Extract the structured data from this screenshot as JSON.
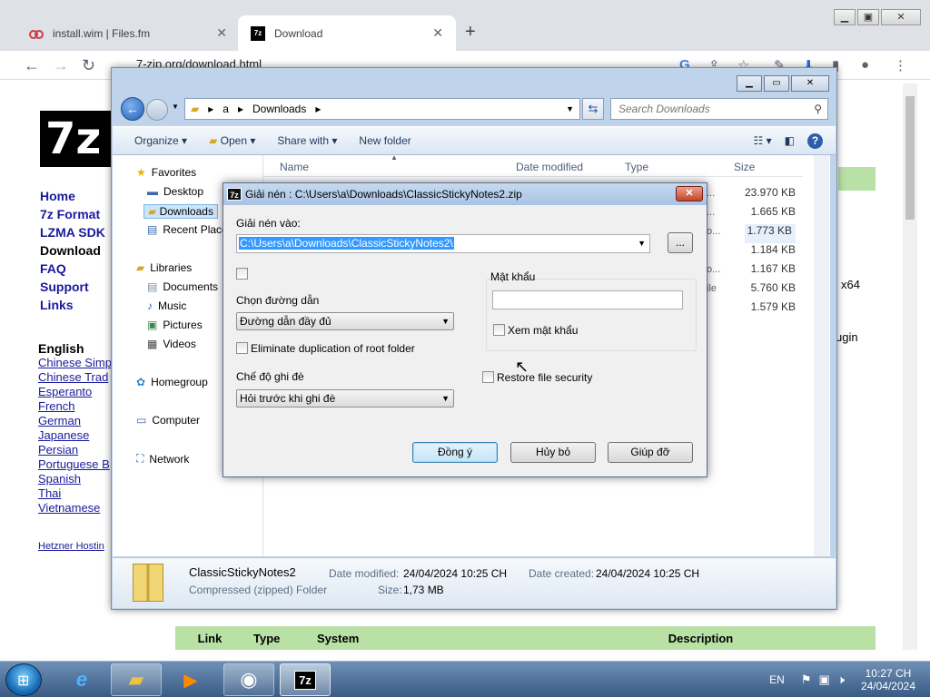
{
  "browser": {
    "tabs": [
      {
        "label": "install.wim | Files.fm",
        "close": "✕"
      },
      {
        "label": "Download",
        "close": "✕"
      }
    ],
    "new_tab": "+",
    "url": "7-zip.org/download.html"
  },
  "site": {
    "logo": "7z",
    "nav": [
      "Home",
      "7z Format",
      "LZMA SDK",
      "Download",
      "FAQ",
      "Support",
      "Links"
    ],
    "languages_heading": "English",
    "languages": [
      "Chinese Simp",
      "Chinese Trad",
      "Esperanto",
      "French",
      "German",
      "Japanese",
      "Persian",
      "Portuguese B",
      "Spanish",
      "Thai",
      "Vietnamese"
    ],
    "hosting": "Hetzner Hostin",
    "x64": "x64",
    "ugin": "ugin",
    "table_headers": [
      "Link",
      "Type",
      "System",
      "Description"
    ]
  },
  "explorer": {
    "address": {
      "root": "a",
      "folder": "Downloads"
    },
    "search_placeholder": "Search Downloads",
    "toolbar": {
      "organize": "Organize",
      "open": "Open",
      "share_with": "Share with",
      "new_folder": "New folder"
    },
    "columns": {
      "name": "Name",
      "date_modified": "Date modified",
      "type": "Type",
      "size": "Size"
    },
    "nav": {
      "favorites": "Favorites",
      "desktop": "Desktop",
      "downloads": "Downloads",
      "recent": "Recent Places",
      "libraries": "Libraries",
      "documents": "Documents",
      "music": "Music",
      "pictures": "Pictures",
      "videos": "Videos",
      "homegroup": "Homegroup",
      "computer": "Computer",
      "network": "Network"
    },
    "sizes": [
      "23.970 KB",
      "1.665 KB",
      "1.773 KB",
      "1.184 KB",
      "1.167 KB",
      "5.760 KB",
      "1.579 KB"
    ],
    "partial_types": [
      "...",
      "...",
      "o...",
      "",
      "o...",
      "ile",
      ""
    ],
    "details": {
      "name": "ClassicStickyNotes2",
      "type": "Compressed (zipped) Folder",
      "modified_label": "Date modified:",
      "modified_value": "24/04/2024 10:25 CH",
      "created_label": "Date created:",
      "created_value": "24/04/2024 10:25 CH",
      "size_label": "Size:",
      "size_value": "1,73 MB"
    }
  },
  "dialog": {
    "icon": "7z",
    "title": "Giải nén : C:\\Users\\a\\Downloads\\ClassicStickyNotes2.zip",
    "close": "✕",
    "extract_to_label": "Giải nén vào:",
    "extract_to_value": "C:\\Users\\a\\Downloads\\ClassicStickyNotes2\\",
    "browse": "...",
    "path_mode_label": "Chọn đường dẫn",
    "path_mode_value": "Đường dẫn đầy đủ",
    "eliminate_dup": "Eliminate duplication of root folder",
    "overwrite_label": "Chế độ ghi đè",
    "overwrite_value": "Hỏi trước khi ghi đè",
    "password_label": "Mật khẩu",
    "show_password": "Xem mật khẩu",
    "restore_security": "Restore file security",
    "ok": "Đồng ý",
    "cancel": "Hủy bỏ",
    "help": "Giúp đỡ"
  },
  "taskbar": {
    "lang": "EN",
    "time": "10:27 CH",
    "date": "24/04/2024"
  }
}
